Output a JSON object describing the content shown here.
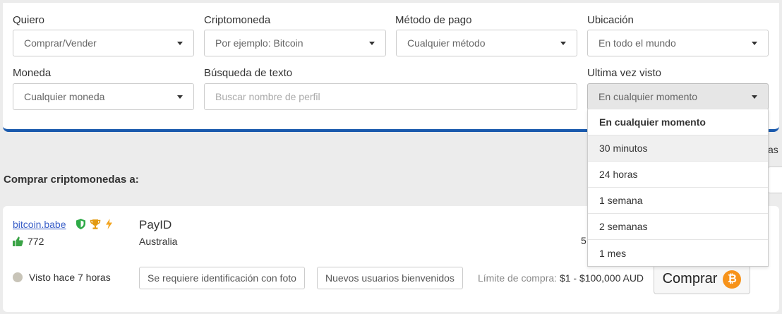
{
  "filters": {
    "want": {
      "label": "Quiero",
      "value": "Comprar/Vender"
    },
    "crypto": {
      "label": "Criptomoneda",
      "value": "Por ejemplo: Bitcoin"
    },
    "payment": {
      "label": "Método de pago",
      "value": "Cualquier método"
    },
    "location": {
      "label": "Ubicación",
      "value": "En todo el mundo"
    },
    "currency": {
      "label": "Moneda",
      "value": "Cualquier moneda"
    },
    "search": {
      "label": "Búsqueda de texto",
      "placeholder": "Buscar nombre de perfil"
    },
    "last_seen": {
      "label": "Ultima vez visto",
      "value": "En cualquier momento",
      "options": [
        "En cualquier momento",
        "30 minutos",
        "24 horas",
        "1 semana",
        "2 semanas",
        "1 mes"
      ]
    }
  },
  "hidden_peek_text": "as",
  "section_title": "Comprar criptomonedas a:",
  "offer": {
    "username": "bitcoin.babe",
    "feedback": "772",
    "method": "PayID",
    "location": "Australia",
    "price_partial": "5",
    "seen": "Visto hace 7 horas",
    "tags": [
      "Se requiere identificación con foto",
      "Nuevos usuarios bienvenidos"
    ],
    "limit_label": "Límite de compra:",
    "limit_value": "$1 - $100,000 AUD",
    "buy_label": "Comprar",
    "btc_symbol": "₿"
  },
  "colors": {
    "accent_border": "#1a5aad",
    "link": "#3a5fc8",
    "shield": "#2eaa47",
    "trophy": "#e39a12",
    "bolt": "#f3a521",
    "thumb": "#3aa346",
    "bitcoin": "#f7931a"
  }
}
